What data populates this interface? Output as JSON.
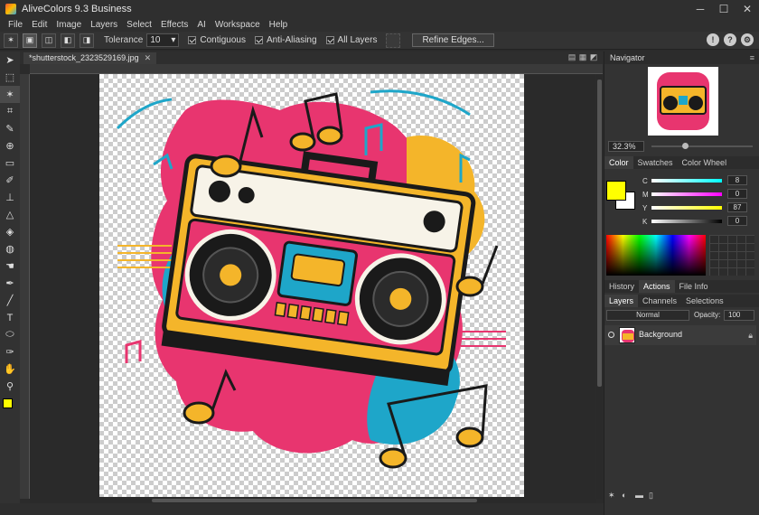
{
  "window": {
    "title": "AliveColors 9.3 Business",
    "min": "─",
    "max": "☐",
    "close": "✕"
  },
  "menu": [
    "File",
    "Edit",
    "Image",
    "Layers",
    "Select",
    "Effects",
    "AI",
    "Workspace",
    "Help"
  ],
  "options": {
    "tolerance_label": "Tolerance",
    "tolerance_value": "10",
    "contiguous": "Contiguous",
    "anti_aliasing": "Anti-Aliasing",
    "all_layers": "All Layers",
    "refine_edges": "Refine Edges..."
  },
  "document": {
    "tab": "*shutterstock_2323529169.jpg",
    "close": "✕"
  },
  "navigator": {
    "title": "Navigator",
    "zoom": "32.3%"
  },
  "color_panel": {
    "tabs": [
      "Color",
      "Swatches",
      "Color Wheel"
    ],
    "channels": [
      {
        "label": "C",
        "value": "8"
      },
      {
        "label": "M",
        "value": "0"
      },
      {
        "label": "Y",
        "value": "87"
      },
      {
        "label": "K",
        "value": "0"
      }
    ]
  },
  "history_tabs": [
    "History",
    "Actions",
    "File Info"
  ],
  "layers_tabs": [
    "Layers",
    "Channels",
    "Selections"
  ],
  "layers": {
    "blend_mode": "Normal",
    "opacity_label": "Opacity:",
    "opacity_value": "100",
    "items": [
      {
        "name": "Background"
      }
    ]
  },
  "colors": {
    "foreground": "#ffff00",
    "background": "#ffffff",
    "accent_pink": "#e8356f",
    "accent_teal": "#1ea6c9",
    "accent_yellow": "#f4b52a"
  }
}
